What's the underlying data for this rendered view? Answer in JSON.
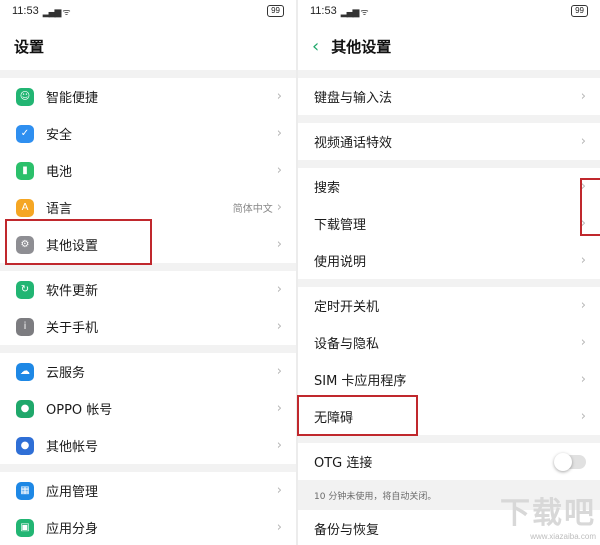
{
  "left": {
    "status": {
      "time": "11:53",
      "signal": "ᵢₗ",
      "battery": "99"
    },
    "title": "设置",
    "sections": [
      [
        {
          "label": "智能便捷",
          "icon": "smart-assist-icon",
          "color": "#22b573",
          "glyph": "☺"
        },
        {
          "label": "安全",
          "icon": "shield-icon",
          "color": "#2f8ff0",
          "glyph": "✓"
        },
        {
          "label": "电池",
          "icon": "battery-icon",
          "color": "#2bc06b",
          "glyph": "▮"
        },
        {
          "label": "语言",
          "icon": "language-icon",
          "color": "#f5a623",
          "glyph": "A",
          "value": "简体中文"
        },
        {
          "label": "其他设置",
          "icon": "gear-icon",
          "color": "#8e8e93",
          "glyph": "⚙"
        }
      ],
      [
        {
          "label": "软件更新",
          "icon": "update-icon",
          "color": "#22b573",
          "glyph": "↻"
        },
        {
          "label": "关于手机",
          "icon": "info-icon",
          "color": "#7c7c80",
          "glyph": "i"
        }
      ],
      [
        {
          "label": "云服务",
          "icon": "cloud-icon",
          "color": "#1e88e5",
          "glyph": "☁"
        },
        {
          "label": "OPPO 帐号",
          "icon": "person-icon",
          "color": "#1fa86b",
          "glyph": "●"
        },
        {
          "label": "其他帐号",
          "icon": "person-icon",
          "color": "#2f6fd6",
          "glyph": "●"
        }
      ],
      [
        {
          "label": "应用管理",
          "icon": "apps-icon",
          "color": "#1e88e5",
          "glyph": "▦"
        },
        {
          "label": "应用分身",
          "icon": "app-clone-icon",
          "color": "#22b573",
          "glyph": "▣"
        }
      ]
    ]
  },
  "right": {
    "status": {
      "time": "11:53",
      "signal": "ᵢₗ",
      "battery": "99"
    },
    "back": "‹",
    "title": "其他设置",
    "sections": [
      [
        {
          "label": "键盘与输入法"
        }
      ],
      [
        {
          "label": "视频通话特效"
        }
      ],
      [
        {
          "label": "搜索"
        },
        {
          "label": "下载管理"
        },
        {
          "label": "使用说明"
        }
      ],
      [
        {
          "label": "定时开关机"
        },
        {
          "label": "设备与隐私"
        },
        {
          "label": "SIM 卡应用程序"
        },
        {
          "label": "无障碍"
        }
      ]
    ],
    "otg": {
      "label": "OTG 连接",
      "hint": "10 分钟未使用，将自动关闭。"
    },
    "backup": {
      "label": "备份与恢复"
    }
  },
  "chevron": "›",
  "watermark": {
    "big": "下载吧",
    "url": "www.xiazaiba.com"
  },
  "accent": "#c0282d"
}
